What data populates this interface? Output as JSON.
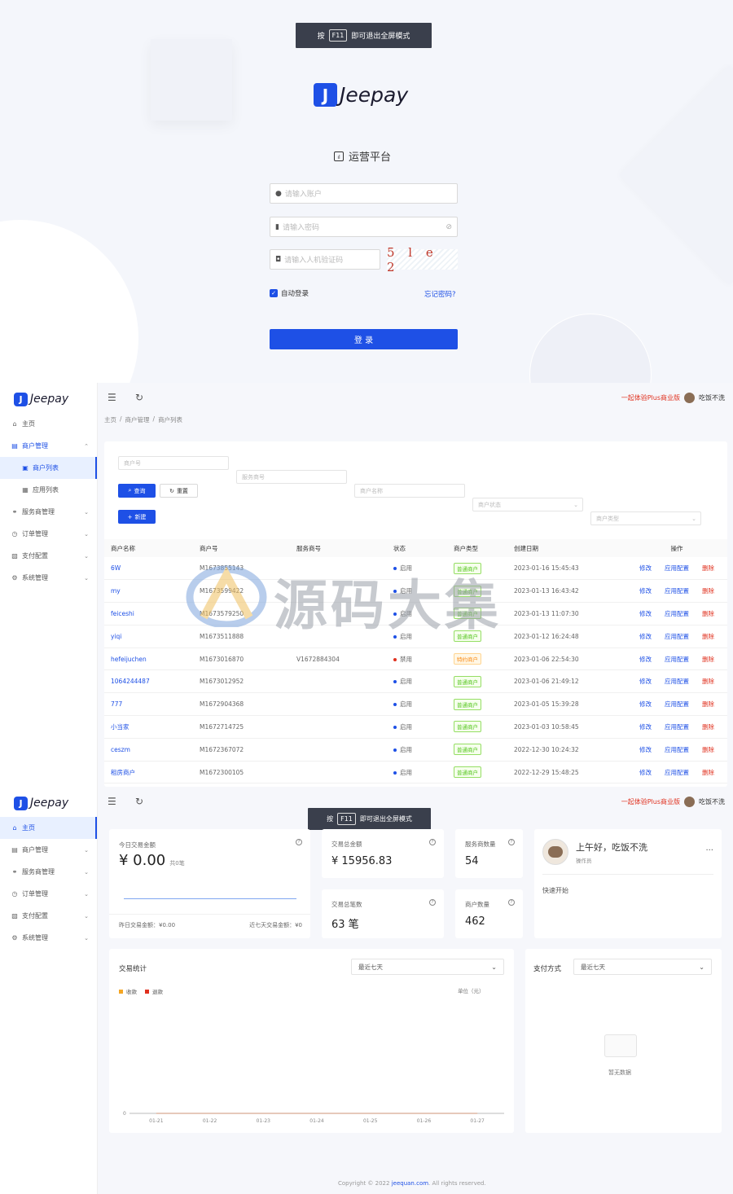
{
  "login": {
    "banner": {
      "pre": "按",
      "key": "F11",
      "post": "即可退出全屏模式"
    },
    "brand": "Jeepay",
    "platform_title": "运营平台",
    "account_placeholder": "请输入账户",
    "password_placeholder": "请输入密码",
    "captcha_placeholder": "请输入人机验证码",
    "captcha_text": "5 l e 2",
    "auto_login": "自动登录",
    "forgot": "忘记密码?",
    "submit": "登 录"
  },
  "merchant_page": {
    "brand": "Jeepay",
    "topbar": {
      "plus": "一起体验Plus商业版",
      "user": "吃饭不洗"
    },
    "breadcrumb": [
      "主页",
      "商户管理",
      "商户列表"
    ],
    "sidebar": [
      {
        "icon": "⌂",
        "label": "主页"
      },
      {
        "icon": "▤",
        "label": "商户管理",
        "arrow": "⌃"
      },
      {
        "icon": "▣",
        "label": "商户列表"
      },
      {
        "icon": "▦",
        "label": "应用列表"
      },
      {
        "icon": "⚭",
        "label": "服务商管理",
        "arrow": "⌄"
      },
      {
        "icon": "◷",
        "label": "订单管理",
        "arrow": "⌄"
      },
      {
        "icon": "▧",
        "label": "支付配置",
        "arrow": "⌄"
      },
      {
        "icon": "⚙",
        "label": "系统管理",
        "arrow": "⌄"
      }
    ],
    "filters": [
      "商户号",
      "服务商号",
      "商户名称",
      "商户状态",
      "商户类型"
    ],
    "btn_query": "查询",
    "btn_reset": "重置",
    "btn_new": "新建",
    "columns": [
      "商户名称",
      "商户号",
      "服务商号",
      "状态",
      "商户类型",
      "创建日期",
      "操作"
    ],
    "actions": [
      "修改",
      "应用配置",
      "删除"
    ],
    "rows": [
      {
        "name": "6W",
        "no": "M1673855143",
        "isv": "",
        "status": "启用",
        "status_color": "#1e50e6",
        "type": "普通商户",
        "type_style": "green",
        "date": "2023-01-16 15:45:43"
      },
      {
        "name": "my",
        "no": "M1673599422",
        "isv": "",
        "status": "启用",
        "status_color": "#1e50e6",
        "type": "普通商户",
        "type_style": "green",
        "date": "2023-01-13 16:43:42"
      },
      {
        "name": "feiceshi",
        "no": "M1673579250",
        "isv": "",
        "status": "启用",
        "status_color": "#1e50e6",
        "type": "普通商户",
        "type_style": "green",
        "date": "2023-01-13 11:07:30"
      },
      {
        "name": "yiqi",
        "no": "M1673511888",
        "isv": "",
        "status": "启用",
        "status_color": "#1e50e6",
        "type": "普通商户",
        "type_style": "green",
        "date": "2023-01-12 16:24:48"
      },
      {
        "name": "hefeijuchen",
        "no": "M1673016870",
        "isv": "V1672884304",
        "status": "禁用",
        "status_color": "#e0301e",
        "type": "特约商户",
        "type_style": "orange",
        "date": "2023-01-06 22:54:30"
      },
      {
        "name": "1064244487",
        "no": "M1673012952",
        "isv": "",
        "status": "启用",
        "status_color": "#1e50e6",
        "type": "普通商户",
        "type_style": "green",
        "date": "2023-01-06 21:49:12"
      },
      {
        "name": "777",
        "no": "M1672904368",
        "isv": "",
        "status": "启用",
        "status_color": "#1e50e6",
        "type": "普通商户",
        "type_style": "green",
        "date": "2023-01-05 15:39:28"
      },
      {
        "name": "小当家",
        "no": "M1672714725",
        "isv": "",
        "status": "启用",
        "status_color": "#1e50e6",
        "type": "普通商户",
        "type_style": "green",
        "date": "2023-01-03 10:58:45"
      },
      {
        "name": "ceszm",
        "no": "M1672367072",
        "isv": "",
        "status": "启用",
        "status_color": "#1e50e6",
        "type": "普通商户",
        "type_style": "green",
        "date": "2022-12-30 10:24:32"
      },
      {
        "name": "租房商户",
        "no": "M1672300105",
        "isv": "",
        "status": "启用",
        "status_color": "#1e50e6",
        "type": "普通商户",
        "type_style": "green",
        "date": "2022-12-29 15:48:25"
      }
    ]
  },
  "watermark": "源码大集",
  "dashboard": {
    "brand": "Jeepay",
    "topbar": {
      "plus": "一起体验Plus商业版",
      "user": "吃饭不洗"
    },
    "banner": {
      "pre": "按",
      "key": "F11",
      "post": "即可退出全屏模式"
    },
    "sidebar": [
      {
        "icon": "⌂",
        "label": "主页"
      },
      {
        "icon": "▤",
        "label": "商户管理",
        "arrow": "⌄"
      },
      {
        "icon": "⚭",
        "label": "服务商管理",
        "arrow": "⌄"
      },
      {
        "icon": "◷",
        "label": "订单管理",
        "arrow": "⌄"
      },
      {
        "icon": "▧",
        "label": "支付配置",
        "arrow": "⌄"
      },
      {
        "icon": "⚙",
        "label": "系统管理",
        "arrow": "⌄"
      }
    ],
    "today": {
      "label": "今日交易金额",
      "amount": "¥ 0.00",
      "count": "共0笔",
      "yesterday": "昨日交易金额：¥0.00",
      "week": "近七天交易金额：¥0"
    },
    "total_amount": {
      "label": "交易总金额",
      "value": "¥ 15956.83"
    },
    "isv_count": {
      "label": "服务商数量",
      "value": "54"
    },
    "total_count": {
      "label": "交易总笔数",
      "value": "63 笔"
    },
    "merchant_count": {
      "label": "商户数量",
      "value": "462"
    },
    "user": {
      "greeting": "上午好，吃饭不洗",
      "role": "操作员",
      "more": "...",
      "quick": "快速开始"
    },
    "trade_stats": {
      "title": "交易统计",
      "range": "最近七天",
      "legend": [
        "收款",
        "退款"
      ],
      "unit": "单位（元）"
    },
    "pay_method": {
      "title": "支付方式",
      "range": "最近七天",
      "empty": "暂无数据"
    },
    "footer": {
      "pre": "Copyright © 2022 ",
      "link": "jeequan.com",
      "post": ". All rights reserved."
    }
  },
  "chart_data": {
    "type": "line",
    "categories": [
      "01-21",
      "01-22",
      "01-23",
      "01-24",
      "01-25",
      "01-26",
      "01-27"
    ],
    "series": [
      {
        "name": "收款",
        "values": [
          0,
          0,
          0,
          0,
          0,
          0,
          0
        ],
        "color": "#f5a623"
      },
      {
        "name": "退款",
        "values": [
          0,
          0,
          0,
          0,
          0,
          0,
          0
        ],
        "color": "#e0301e"
      }
    ],
    "y_ticks": [
      "0"
    ],
    "title": "交易统计",
    "ylabel": "单位（元）"
  }
}
